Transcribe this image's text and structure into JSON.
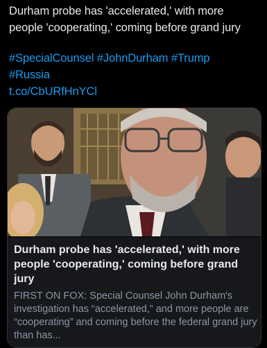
{
  "tweet": {
    "headline": "Durham probe has 'accelerated,' with more people 'cooperating,' coming before grand jury",
    "hashtags": [
      "#SpecialCounsel",
      "#JohnDurham",
      "#Trump",
      "#Russia"
    ],
    "link": "t.co/CbURfHnYCl"
  },
  "card": {
    "image_alt": "Photo of John Durham with people in background",
    "title": "Durham probe has 'accelerated,' with more people 'cooperating,' coming before grand jury",
    "description": "FIRST ON FOX: Special Counsel John Durham's investigation has “accelerated,” and more people are “cooperating” and coming before the federal grand jury than has..."
  },
  "colors": {
    "background": "#000000",
    "text": "#e7e9ea",
    "link": "#1d9bf0",
    "card_body": "#16181c",
    "muted": "#8b98a5"
  }
}
